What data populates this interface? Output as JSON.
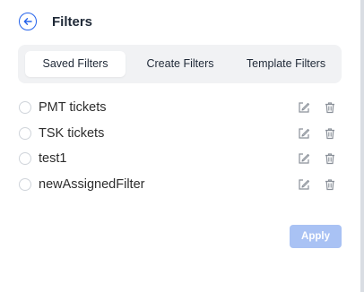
{
  "header": {
    "title": "Filters",
    "back_icon": "arrow-left-icon"
  },
  "tabs": [
    {
      "label": "Saved Filters",
      "active": true
    },
    {
      "label": "Create Filters",
      "active": false
    },
    {
      "label": "Template Filters",
      "active": false
    }
  ],
  "filters": [
    {
      "label": "PMT tickets"
    },
    {
      "label": "TSK tickets"
    },
    {
      "label": "test1"
    },
    {
      "label": "newAssignedFilter"
    }
  ],
  "apply_label": "Apply",
  "colors": {
    "accent": "#2563eb",
    "apply_disabled": "#a9c2f4",
    "tab_bg": "#f1f2f4",
    "icon_gray": "#8a9099"
  }
}
